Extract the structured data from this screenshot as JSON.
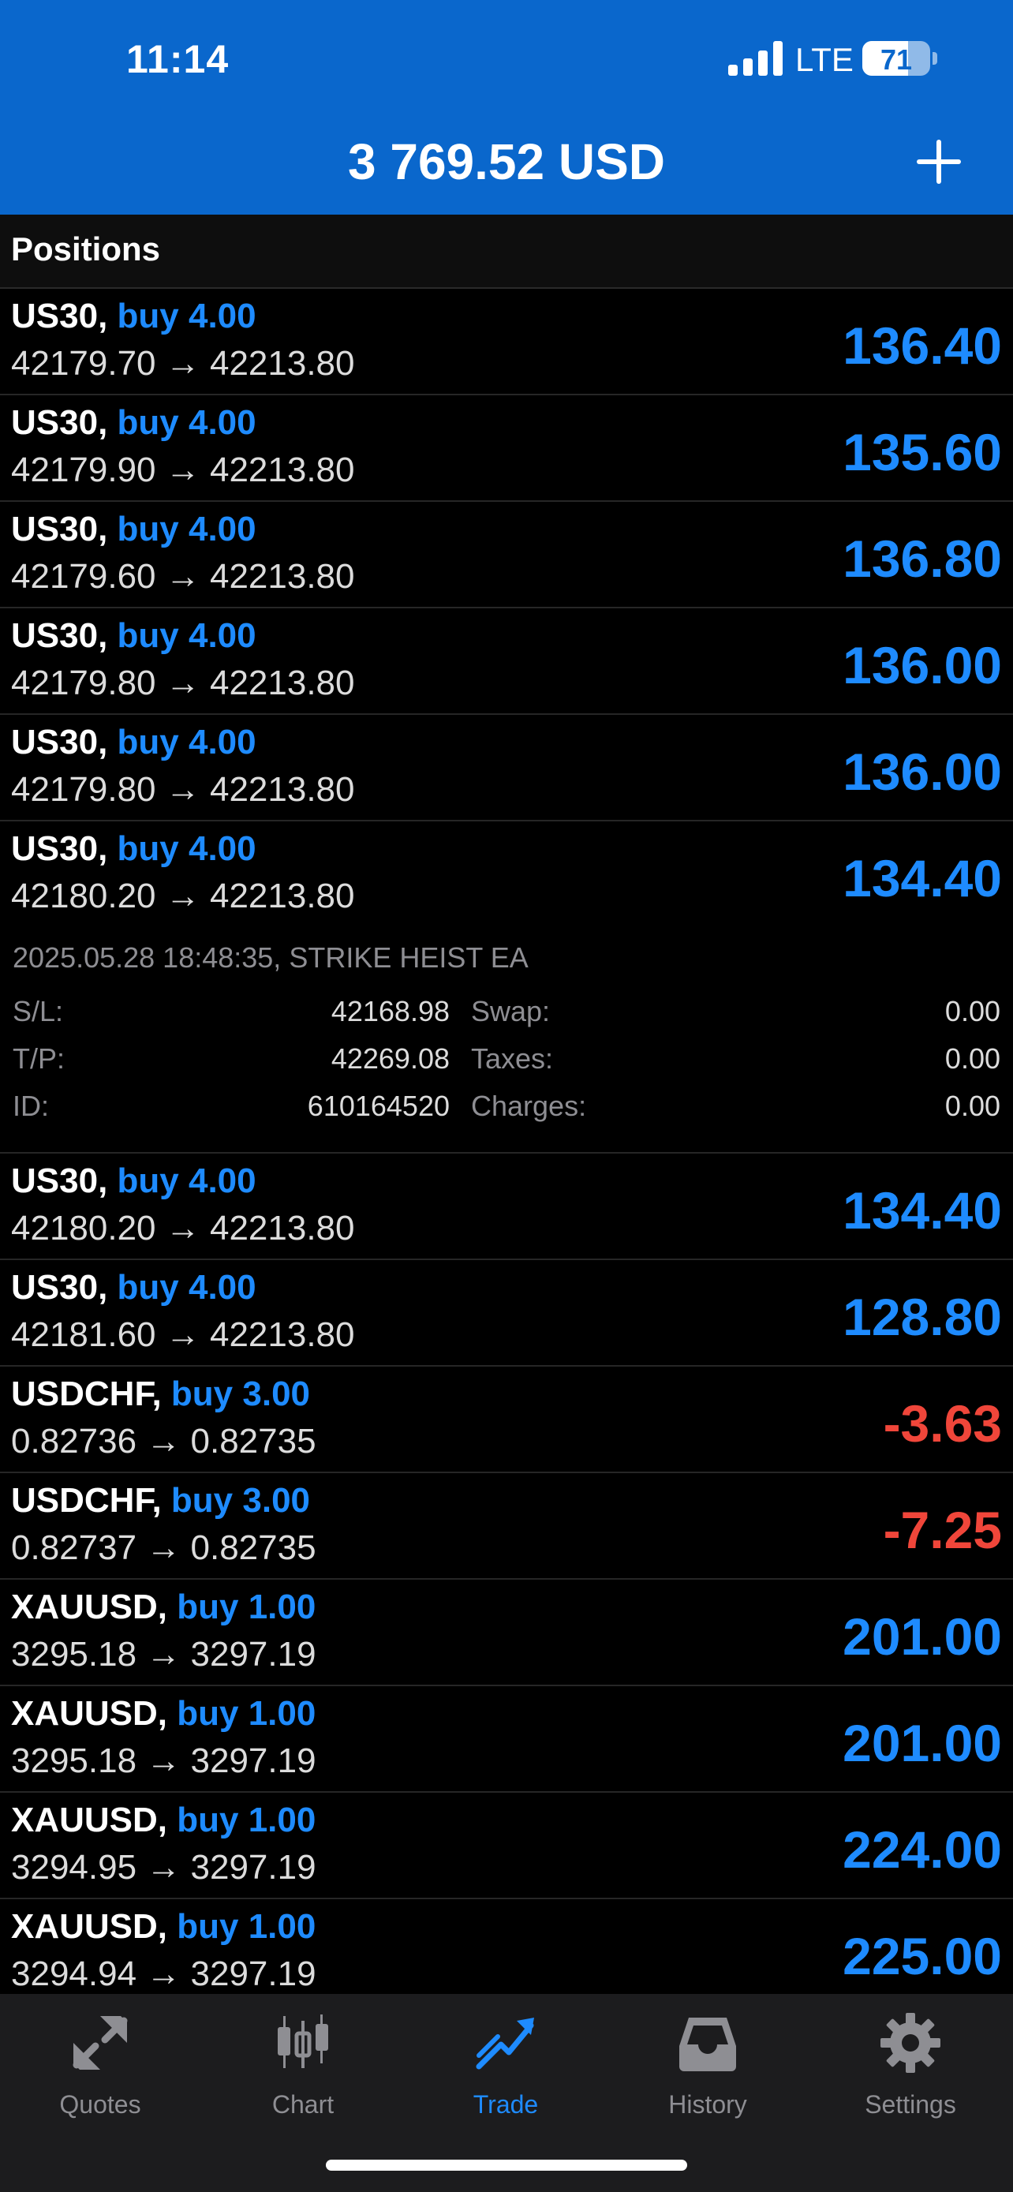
{
  "status": {
    "time": "11:14",
    "network": "LTE",
    "battery": "71"
  },
  "header": {
    "balance": "3 769.52 USD"
  },
  "section_title": "Positions",
  "positions": [
    {
      "symbol": "US30,",
      "side": "buy 4.00",
      "prices": "42179.70 → 42213.80",
      "profit": "136.40"
    },
    {
      "symbol": "US30,",
      "side": "buy 4.00",
      "prices": "42179.90 → 42213.80",
      "profit": "135.60"
    },
    {
      "symbol": "US30,",
      "side": "buy 4.00",
      "prices": "42179.60 → 42213.80",
      "profit": "136.80"
    },
    {
      "symbol": "US30,",
      "side": "buy 4.00",
      "prices": "42179.80 → 42213.80",
      "profit": "136.00"
    },
    {
      "symbol": "US30,",
      "side": "buy 4.00",
      "prices": "42179.80 → 42213.80",
      "profit": "136.00"
    },
    {
      "symbol": "US30,",
      "side": "buy 4.00",
      "prices": "42180.20 → 42213.80",
      "profit": "134.40"
    },
    {
      "symbol": "US30,",
      "side": "buy 4.00",
      "prices": "42180.20 → 42213.80",
      "profit": "134.40"
    },
    {
      "symbol": "US30,",
      "side": "buy 4.00",
      "prices": "42181.60 → 42213.80",
      "profit": "128.80"
    },
    {
      "symbol": "USDCHF,",
      "side": "buy 3.00",
      "prices": "0.82736 → 0.82735",
      "profit": "-3.63"
    },
    {
      "symbol": "USDCHF,",
      "side": "buy 3.00",
      "prices": "0.82737 → 0.82735",
      "profit": "-7.25"
    },
    {
      "symbol": "XAUUSD,",
      "side": "buy 1.00",
      "prices": "3295.18 → 3297.19",
      "profit": "201.00"
    },
    {
      "symbol": "XAUUSD,",
      "side": "buy 1.00",
      "prices": "3295.18 → 3297.19",
      "profit": "201.00"
    },
    {
      "symbol": "XAUUSD,",
      "side": "buy 1.00",
      "prices": "3294.95 → 3297.19",
      "profit": "224.00"
    },
    {
      "symbol": "XAUUSD,",
      "side": "buy 1.00",
      "prices": "3294.94 → 3297.19",
      "profit": "225.00"
    }
  ],
  "details": {
    "meta": "2025.05.28 18:48:35, STRIKE HEIST EA",
    "sl_label": "S/L:",
    "sl_value": "42168.98",
    "tp_label": "T/P:",
    "tp_value": "42269.08",
    "id_label": "ID:",
    "id_value": "610164520",
    "swap_label": "Swap:",
    "swap_value": "0.00",
    "taxes_label": "Taxes:",
    "taxes_value": "0.00",
    "charges_label": "Charges:",
    "charges_value": "0.00"
  },
  "tabs": [
    {
      "label": "Quotes",
      "icon": "quotes-icon"
    },
    {
      "label": "Chart",
      "icon": "chart-icon"
    },
    {
      "label": "Trade",
      "icon": "trade-icon"
    },
    {
      "label": "History",
      "icon": "history-icon"
    },
    {
      "label": "Settings",
      "icon": "settings-icon"
    }
  ],
  "colors": {
    "header": "#0a67cc",
    "positive": "#1e8bff",
    "negative": "#f0463a"
  }
}
